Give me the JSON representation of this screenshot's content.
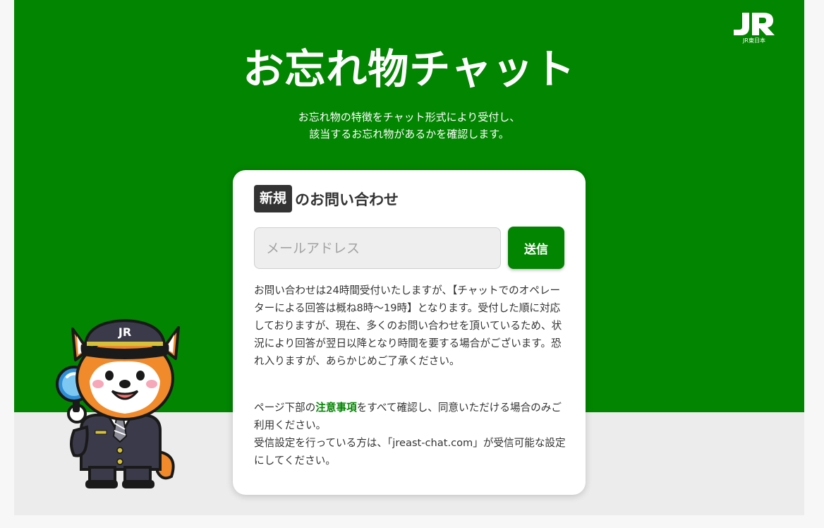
{
  "header": {
    "title": "お忘れ物チャット",
    "subtitle_line1": "お忘れ物の特徴をチャット形式により受付し、",
    "subtitle_line2": "該当するお忘れ物があるかを確認します。",
    "logo_icon": "jr-east-logo",
    "logo_text": "JR東日本"
  },
  "card": {
    "badge": "新規",
    "heading": "のお問い合わせ",
    "email_placeholder": "メールアドレス",
    "email_value": "",
    "send_label": "送信",
    "notice": "お問い合わせは24時間受付いたしますが、【チャットでのオペレーターによる回答は概ね8時～19時】となります。受付した順に対応しておりますが、現在、多くのお問い合わせを頂いているため、状況により回答が翌日以降となり時間を要する場合がございます。恐れ入りますが、あらかじめご了承ください。",
    "notice2_prefix": "ページ下部の",
    "notice2_link": "注意事項",
    "notice2_suffix": "をすべて確認し、同意いただける場合のみご利用ください。",
    "notice3": "受信設定を行っている方は、「jreast-chat.com」が受信可能な設定にしてください。"
  },
  "mascot": {
    "icon": "station-staff-dog-mascot-icon",
    "cap_text": "JR"
  },
  "colors": {
    "brand_green": "#028500",
    "text_dark": "#333333",
    "background_gray": "#ececec"
  }
}
